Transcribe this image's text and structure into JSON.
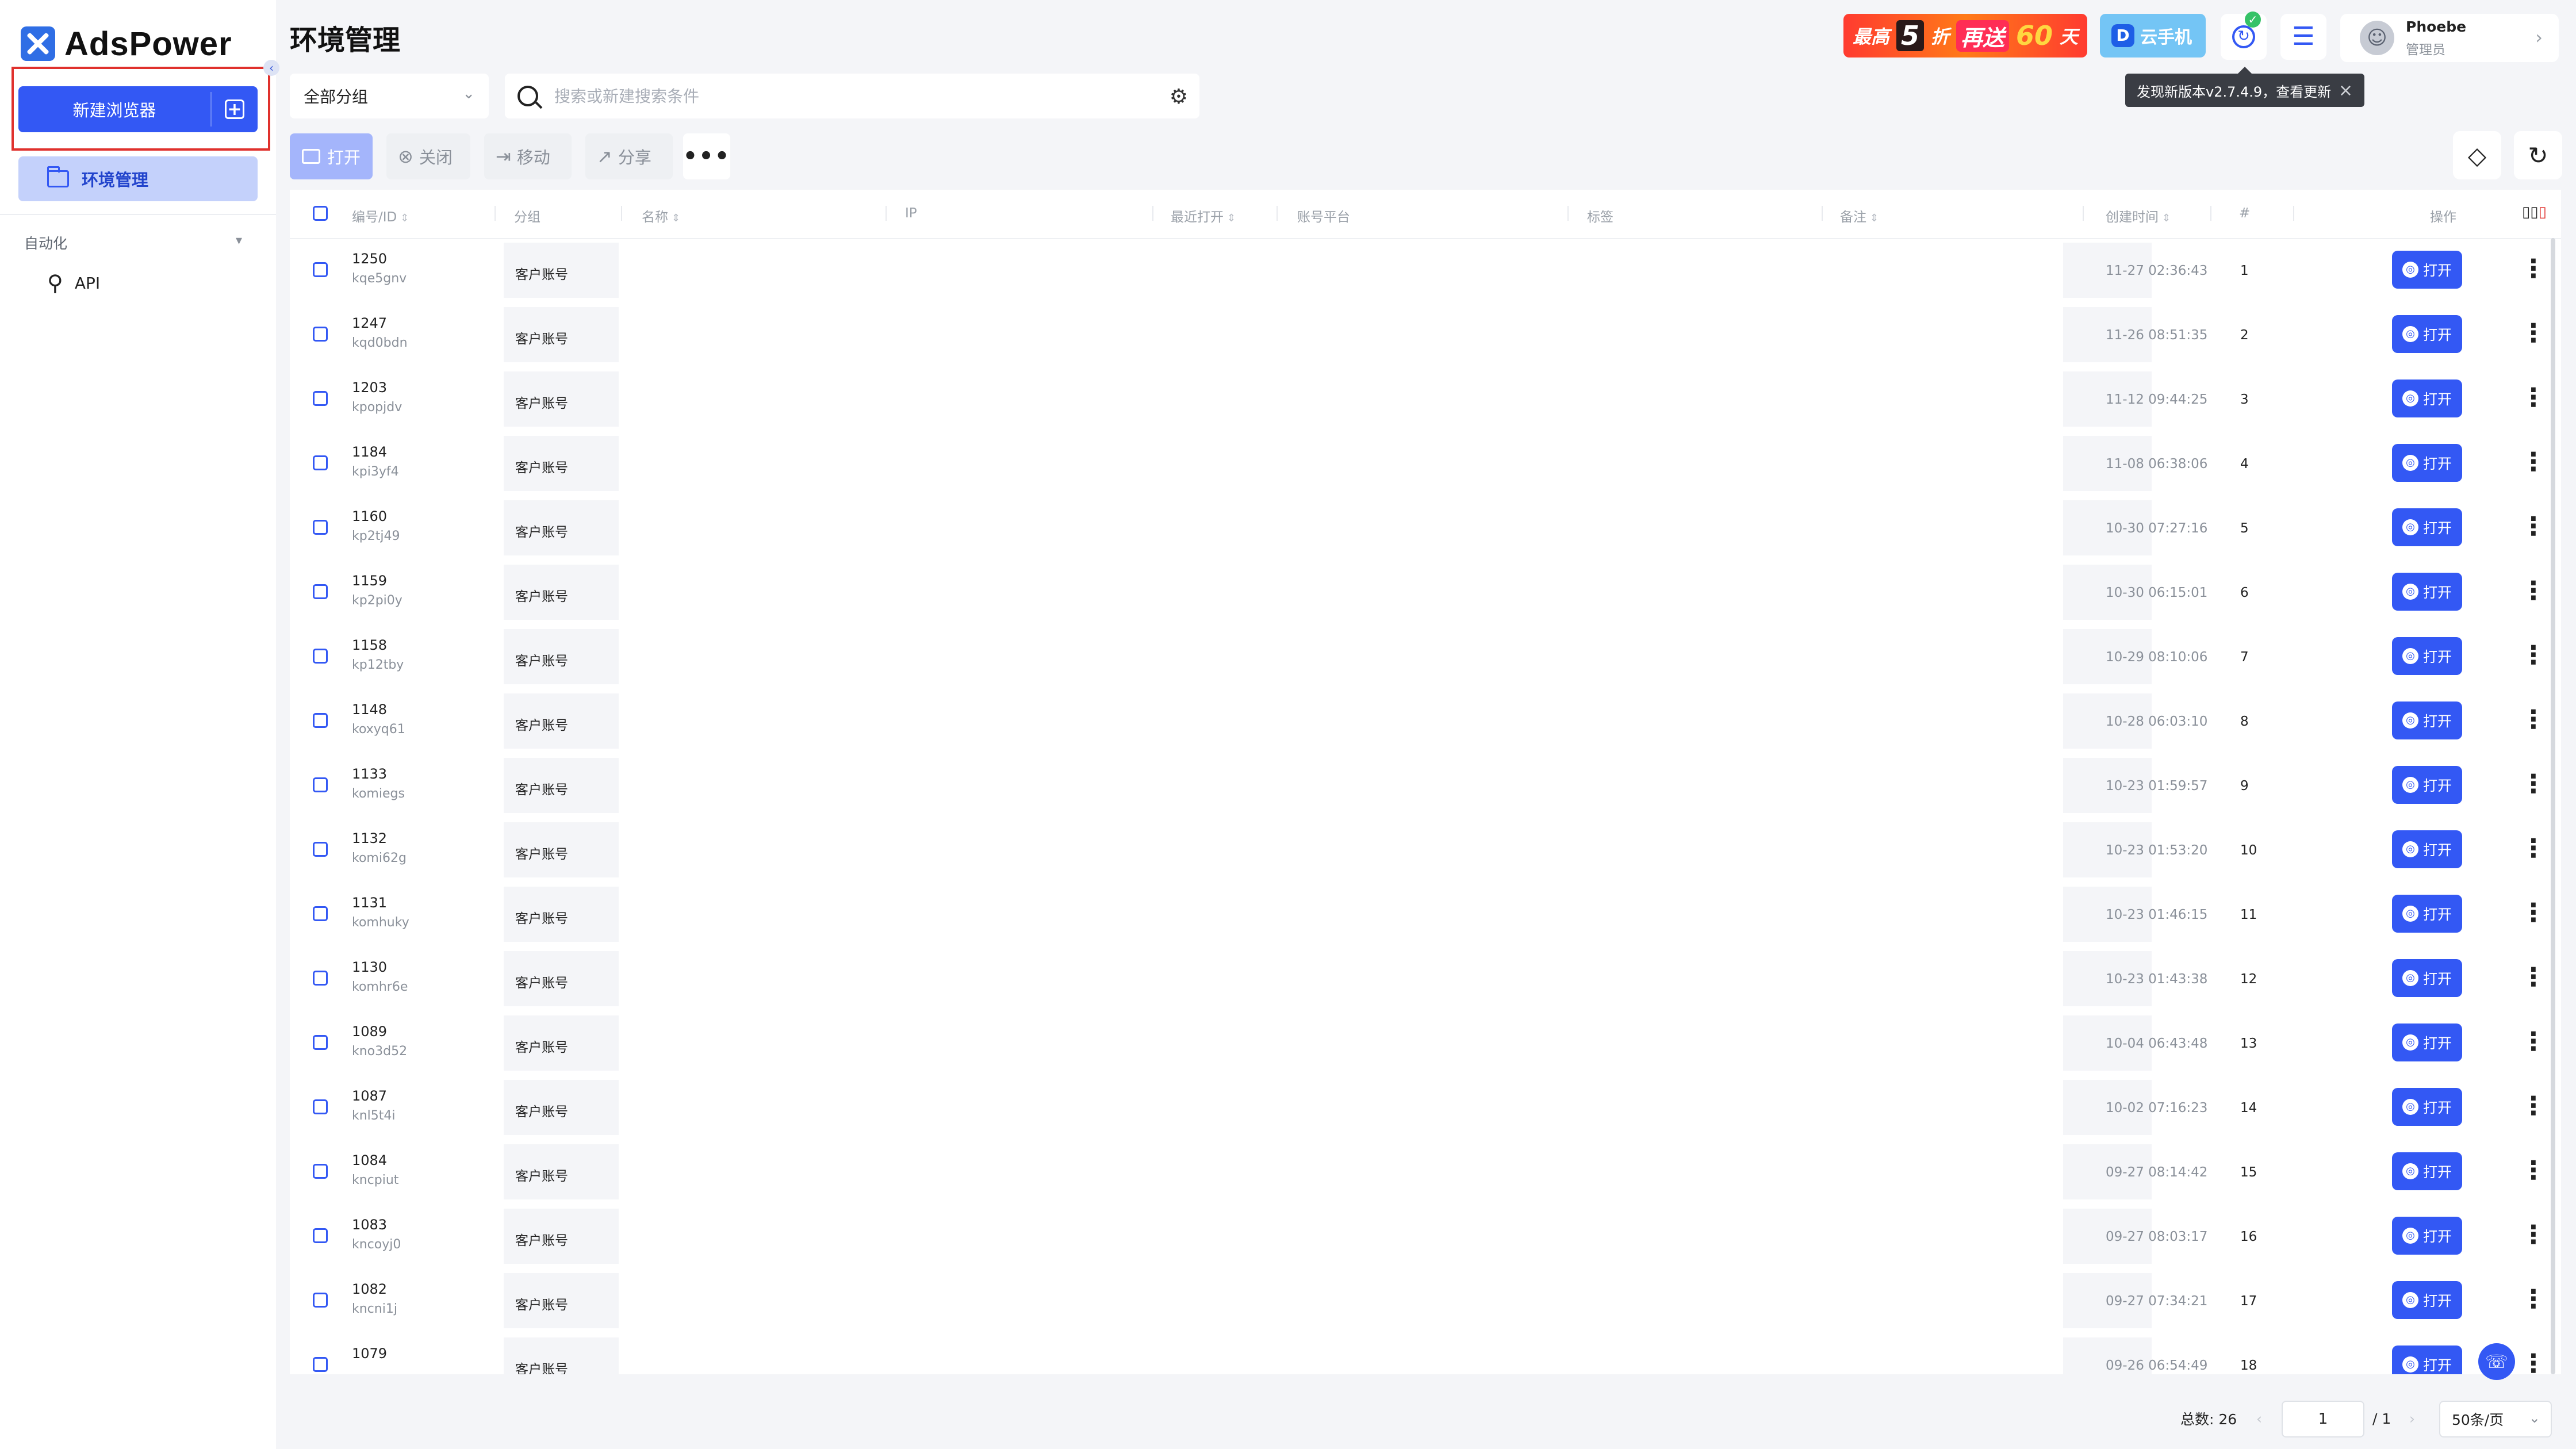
{
  "brand": {
    "name": "AdsPower"
  },
  "sidebar": {
    "new_browser_label": "新建浏览器",
    "env_label": "环境管理",
    "section_automation": "自动化",
    "api_label": "API"
  },
  "header": {
    "title": "环境管理",
    "promo": {
      "part1": "最高",
      "part2": "5",
      "part3": "折",
      "part4": "再送",
      "part5": "60",
      "part6": "天"
    },
    "cloud_phone_label": "云手机",
    "user": {
      "name": "Phoebe",
      "role": "管理员"
    },
    "update_tooltip": "发现新版本v2.7.4.9，查看更新"
  },
  "filter": {
    "group_selected": "全部分组",
    "search_placeholder": "搜索或新建搜索条件"
  },
  "toolbar": {
    "open": "打开",
    "close": "关闭",
    "move": "移动",
    "share": "分享"
  },
  "table": {
    "columns": {
      "id": "编号/ID",
      "group": "分组",
      "name": "名称",
      "ip": "IP",
      "last_open": "最近打开",
      "platform": "账号平台",
      "tags": "标签",
      "remark": "备注",
      "created": "创建时间",
      "index": "#",
      "actions": "操作"
    },
    "open_label": "打开",
    "rows": [
      {
        "num": "1250",
        "id": "kqe5gnv",
        "group": "客户账号",
        "created": "11-27 02:36:43",
        "idx": "1"
      },
      {
        "num": "1247",
        "id": "kqd0bdn",
        "group": "客户账号",
        "created": "11-26 08:51:35",
        "idx": "2"
      },
      {
        "num": "1203",
        "id": "kpopjdv",
        "group": "客户账号",
        "created": "11-12 09:44:25",
        "idx": "3"
      },
      {
        "num": "1184",
        "id": "kpi3yf4",
        "group": "客户账号",
        "created": "11-08 06:38:06",
        "idx": "4"
      },
      {
        "num": "1160",
        "id": "kp2tj49",
        "group": "客户账号",
        "created": "10-30 07:27:16",
        "idx": "5"
      },
      {
        "num": "1159",
        "id": "kp2pi0y",
        "group": "客户账号",
        "created": "10-30 06:15:01",
        "idx": "6"
      },
      {
        "num": "1158",
        "id": "kp12tby",
        "group": "客户账号",
        "created": "10-29 08:10:06",
        "idx": "7"
      },
      {
        "num": "1148",
        "id": "koxyq61",
        "group": "客户账号",
        "created": "10-28 06:03:10",
        "idx": "8"
      },
      {
        "num": "1133",
        "id": "komiegs",
        "group": "客户账号",
        "created": "10-23 01:59:57",
        "idx": "9"
      },
      {
        "num": "1132",
        "id": "komi62g",
        "group": "客户账号",
        "created": "10-23 01:53:20",
        "idx": "10"
      },
      {
        "num": "1131",
        "id": "komhuky",
        "group": "客户账号",
        "created": "10-23 01:46:15",
        "idx": "11"
      },
      {
        "num": "1130",
        "id": "komhr6e",
        "group": "客户账号",
        "created": "10-23 01:43:38",
        "idx": "12"
      },
      {
        "num": "1089",
        "id": "kno3d52",
        "group": "客户账号",
        "created": "10-04 06:43:48",
        "idx": "13"
      },
      {
        "num": "1087",
        "id": "knl5t4i",
        "group": "客户账号",
        "created": "10-02 07:16:23",
        "idx": "14"
      },
      {
        "num": "1084",
        "id": "kncpiut",
        "group": "客户账号",
        "created": "09-27 08:14:42",
        "idx": "15"
      },
      {
        "num": "1083",
        "id": "kncoyj0",
        "group": "客户账号",
        "created": "09-27 08:03:17",
        "idx": "16"
      },
      {
        "num": "1082",
        "id": "kncni1j",
        "group": "客户账号",
        "created": "09-27 07:34:21",
        "idx": "17"
      },
      {
        "num": "1079",
        "id": "",
        "group": "客户账号",
        "created": "09-26 06:54:49",
        "idx": "18"
      }
    ]
  },
  "pagination": {
    "total": "总数: 26",
    "current_page": "1",
    "page_total": "/ 1",
    "page_size": "50条/页"
  }
}
